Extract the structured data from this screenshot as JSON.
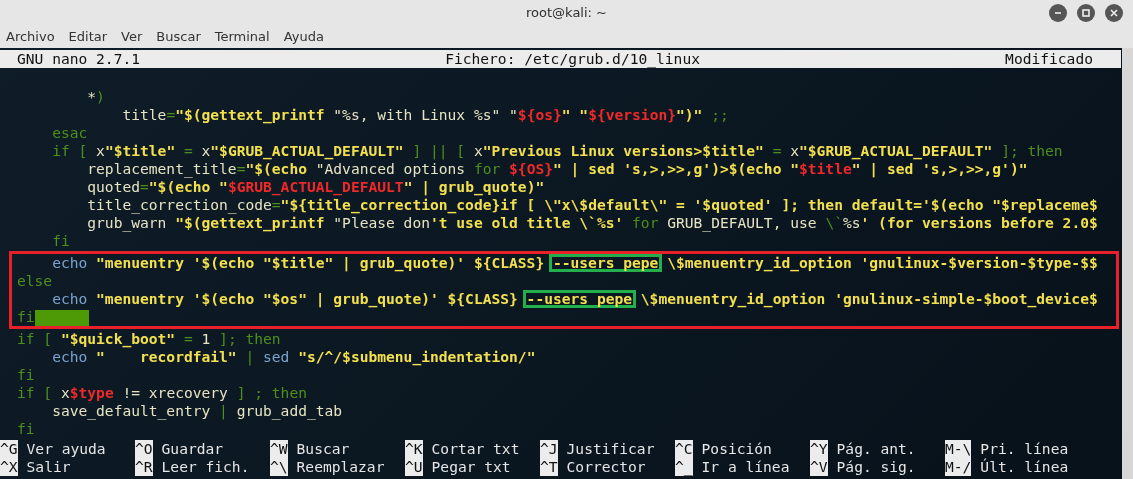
{
  "window": {
    "title": "root@kali: ~"
  },
  "menu": [
    "Archivo",
    "Editar",
    "Ver",
    "Buscar",
    "Terminal",
    "Ayuda"
  ],
  "nano_header": {
    "version": "GNU nano 2.7.1",
    "file": "Fichero: /etc/grub.d/10_linux",
    "status": "Modificado"
  },
  "blocks": [
    {
      "framed": false,
      "lines": [
        {
          "segments": [
            {
              "kind": "text",
              "text": "        *"
            },
            {
              "kind": "keyword",
              "text": ")"
            }
          ]
        },
        {
          "segments": [
            {
              "kind": "text",
              "text": "            title"
            },
            {
              "kind": "keyword",
              "text": "="
            },
            {
              "kind": "string",
              "text": "\"$(gettext_printf "
            },
            {
              "kind": "text",
              "text": "\"%s, with Linux %s\" \""
            },
            {
              "kind": "variable",
              "text": "${os}"
            },
            {
              "kind": "string",
              "text": "\" \""
            },
            {
              "kind": "variable",
              "text": "${version}"
            },
            {
              "kind": "string",
              "text": "\")\" "
            },
            {
              "kind": "keyword",
              "text": ";;"
            }
          ]
        },
        {
          "segments": [
            {
              "kind": "keyword",
              "text": "    esac"
            }
          ]
        },
        {
          "segments": [
            {
              "kind": "keyword",
              "text": "    if [ "
            },
            {
              "kind": "text",
              "text": "x"
            },
            {
              "kind": "string",
              "text": "\"$title\""
            },
            {
              "kind": "keyword",
              "text": " = "
            },
            {
              "kind": "text",
              "text": "x"
            },
            {
              "kind": "string",
              "text": "\"$GRUB_ACTUAL_DEFAULT\""
            },
            {
              "kind": "keyword",
              "text": " ] || [ "
            },
            {
              "kind": "text",
              "text": "x"
            },
            {
              "kind": "string",
              "text": "\"Previous Linux versions>$title\""
            },
            {
              "kind": "keyword",
              "text": " = "
            },
            {
              "kind": "text",
              "text": "x"
            },
            {
              "kind": "string",
              "text": "\"$GRUB_ACTUAL_DEFAULT\""
            },
            {
              "kind": "keyword",
              "text": " ]; then"
            }
          ]
        },
        {
          "segments": [
            {
              "kind": "text",
              "text": "        replacement_title"
            },
            {
              "kind": "keyword",
              "text": "="
            },
            {
              "kind": "string",
              "text": "\"$(echo "
            },
            {
              "kind": "text",
              "text": "\"Advanced options "
            },
            {
              "kind": "keyword",
              "text": "for "
            },
            {
              "kind": "variable",
              "text": "${OS}"
            },
            {
              "kind": "string",
              "text": "\" | sed 's,>,>>,g')>$(echo \""
            },
            {
              "kind": "variable",
              "text": "$title"
            },
            {
              "kind": "string",
              "text": "\" | sed 's,>,>>,g')\""
            }
          ]
        },
        {
          "segments": [
            {
              "kind": "text",
              "text": "        quoted"
            },
            {
              "kind": "keyword",
              "text": "="
            },
            {
              "kind": "string",
              "text": "\"$(echo \""
            },
            {
              "kind": "variable",
              "text": "$GRUB_ACTUAL_DEFAULT"
            },
            {
              "kind": "string",
              "text": "\" | grub_quote)\""
            }
          ]
        },
        {
          "segments": [
            {
              "kind": "text",
              "text": "        title_correction_code"
            },
            {
              "kind": "keyword",
              "text": "="
            },
            {
              "kind": "string",
              "text": "\"${title_correction_code}if [ \\\"x\\$default\\\" = '$quoted' ]; then default='$(echo \"$replaceme$"
            }
          ]
        },
        {
          "segments": [
            {
              "kind": "text",
              "text": "        grub_warn "
            },
            {
              "kind": "string",
              "text": "\"$(gettext_printf "
            },
            {
              "kind": "text",
              "text": "\"Please don"
            },
            {
              "kind": "string",
              "text": "'t use old title \\`%s' "
            },
            {
              "kind": "keyword",
              "text": "for "
            },
            {
              "kind": "text",
              "text": "GRUB_DEFAULT, use "
            },
            {
              "kind": "keyword",
              "text": "\\`"
            },
            {
              "kind": "text",
              "text": "%s"
            },
            {
              "kind": "string",
              "text": "' (for versions before 2.0$"
            }
          ]
        },
        {
          "segments": [
            {
              "kind": "keyword",
              "text": "    fi"
            }
          ]
        }
      ]
    },
    {
      "framed": true,
      "lines": [
        {
          "segments": [
            {
              "kind": "command",
              "text": "    echo "
            },
            {
              "kind": "string",
              "text": "\"menuentry '$(echo \"$title\" | grub_quote)' ${CLASS} "
            },
            {
              "kind": "boxed",
              "text": "--users pepe"
            },
            {
              "kind": "string",
              "text": " \\$menuentry_id_option 'gnulinux-$version-$type-$$"
            }
          ]
        },
        {
          "segments": [
            {
              "kind": "keyword",
              "text": "else"
            }
          ]
        },
        {
          "segments": [
            {
              "kind": "command",
              "text": "    echo "
            },
            {
              "kind": "string",
              "text": "\"menuentry '$(echo \"$os\" | grub_quote)' ${CLASS} "
            },
            {
              "kind": "boxed",
              "text": "--users pepe"
            },
            {
              "kind": "string",
              "text": " \\$menuentry_id_option 'gnulinux-simple-$boot_device$"
            }
          ]
        },
        {
          "segments": [
            {
              "kind": "keyword",
              "text": "fi"
            }
          ],
          "trailing_highlight": true
        }
      ]
    },
    {
      "framed": false,
      "lines": [
        {
          "segments": [
            {
              "kind": "keyword",
              "text": "if [ "
            },
            {
              "kind": "string",
              "text": "\"$quick_boot\""
            },
            {
              "kind": "keyword",
              "text": " = "
            },
            {
              "kind": "text",
              "text": "1"
            },
            {
              "kind": "keyword",
              "text": " ]; then"
            }
          ]
        },
        {
          "segments": [
            {
              "kind": "command",
              "text": "    echo "
            },
            {
              "kind": "string",
              "text": "\"    recordfail\""
            },
            {
              "kind": "keyword",
              "text": " | "
            },
            {
              "kind": "command",
              "text": "sed "
            },
            {
              "kind": "string",
              "text": "\"s/^/$submenu_indentation/\""
            }
          ]
        },
        {
          "segments": [
            {
              "kind": "keyword",
              "text": "fi"
            }
          ]
        },
        {
          "segments": [
            {
              "kind": "keyword",
              "text": "if [ "
            },
            {
              "kind": "text",
              "text": "x"
            },
            {
              "kind": "variable",
              "text": "$type"
            },
            {
              "kind": "text",
              "text": " != xrecovery "
            },
            {
              "kind": "keyword",
              "text": "] ; then"
            }
          ]
        },
        {
          "segments": [
            {
              "kind": "text",
              "text": "    save_default_entry "
            },
            {
              "kind": "keyword",
              "text": "| "
            },
            {
              "kind": "text",
              "text": "grub_add_tab"
            }
          ]
        },
        {
          "segments": [
            {
              "kind": "keyword",
              "text": "fi"
            }
          ]
        }
      ]
    }
  ],
  "shortcuts": [
    [
      {
        "key": "^G",
        "label": "Ver ayuda"
      },
      {
        "key": "^O",
        "label": "Guardar"
      },
      {
        "key": "^W",
        "label": "Buscar"
      },
      {
        "key": "^K",
        "label": "Cortar txt"
      },
      {
        "key": "^J",
        "label": "Justificar"
      },
      {
        "key": "^C",
        "label": "Posición"
      },
      {
        "key": "^Y",
        "label": "Pág. ant."
      },
      {
        "key": "M-\\",
        "label": "Pri. línea"
      }
    ],
    [
      {
        "key": "^X",
        "label": "Salir"
      },
      {
        "key": "^R",
        "label": "Leer fich."
      },
      {
        "key": "^\\",
        "label": "Reemplazar"
      },
      {
        "key": "^U",
        "label": "Pegar txt"
      },
      {
        "key": "^T",
        "label": "Corrector"
      },
      {
        "key": "^_",
        "label": "Ir a línea"
      },
      {
        "key": "^V",
        "label": "Pág. sig."
      },
      {
        "key": "M-/",
        "label": "Últ. línea"
      }
    ]
  ]
}
